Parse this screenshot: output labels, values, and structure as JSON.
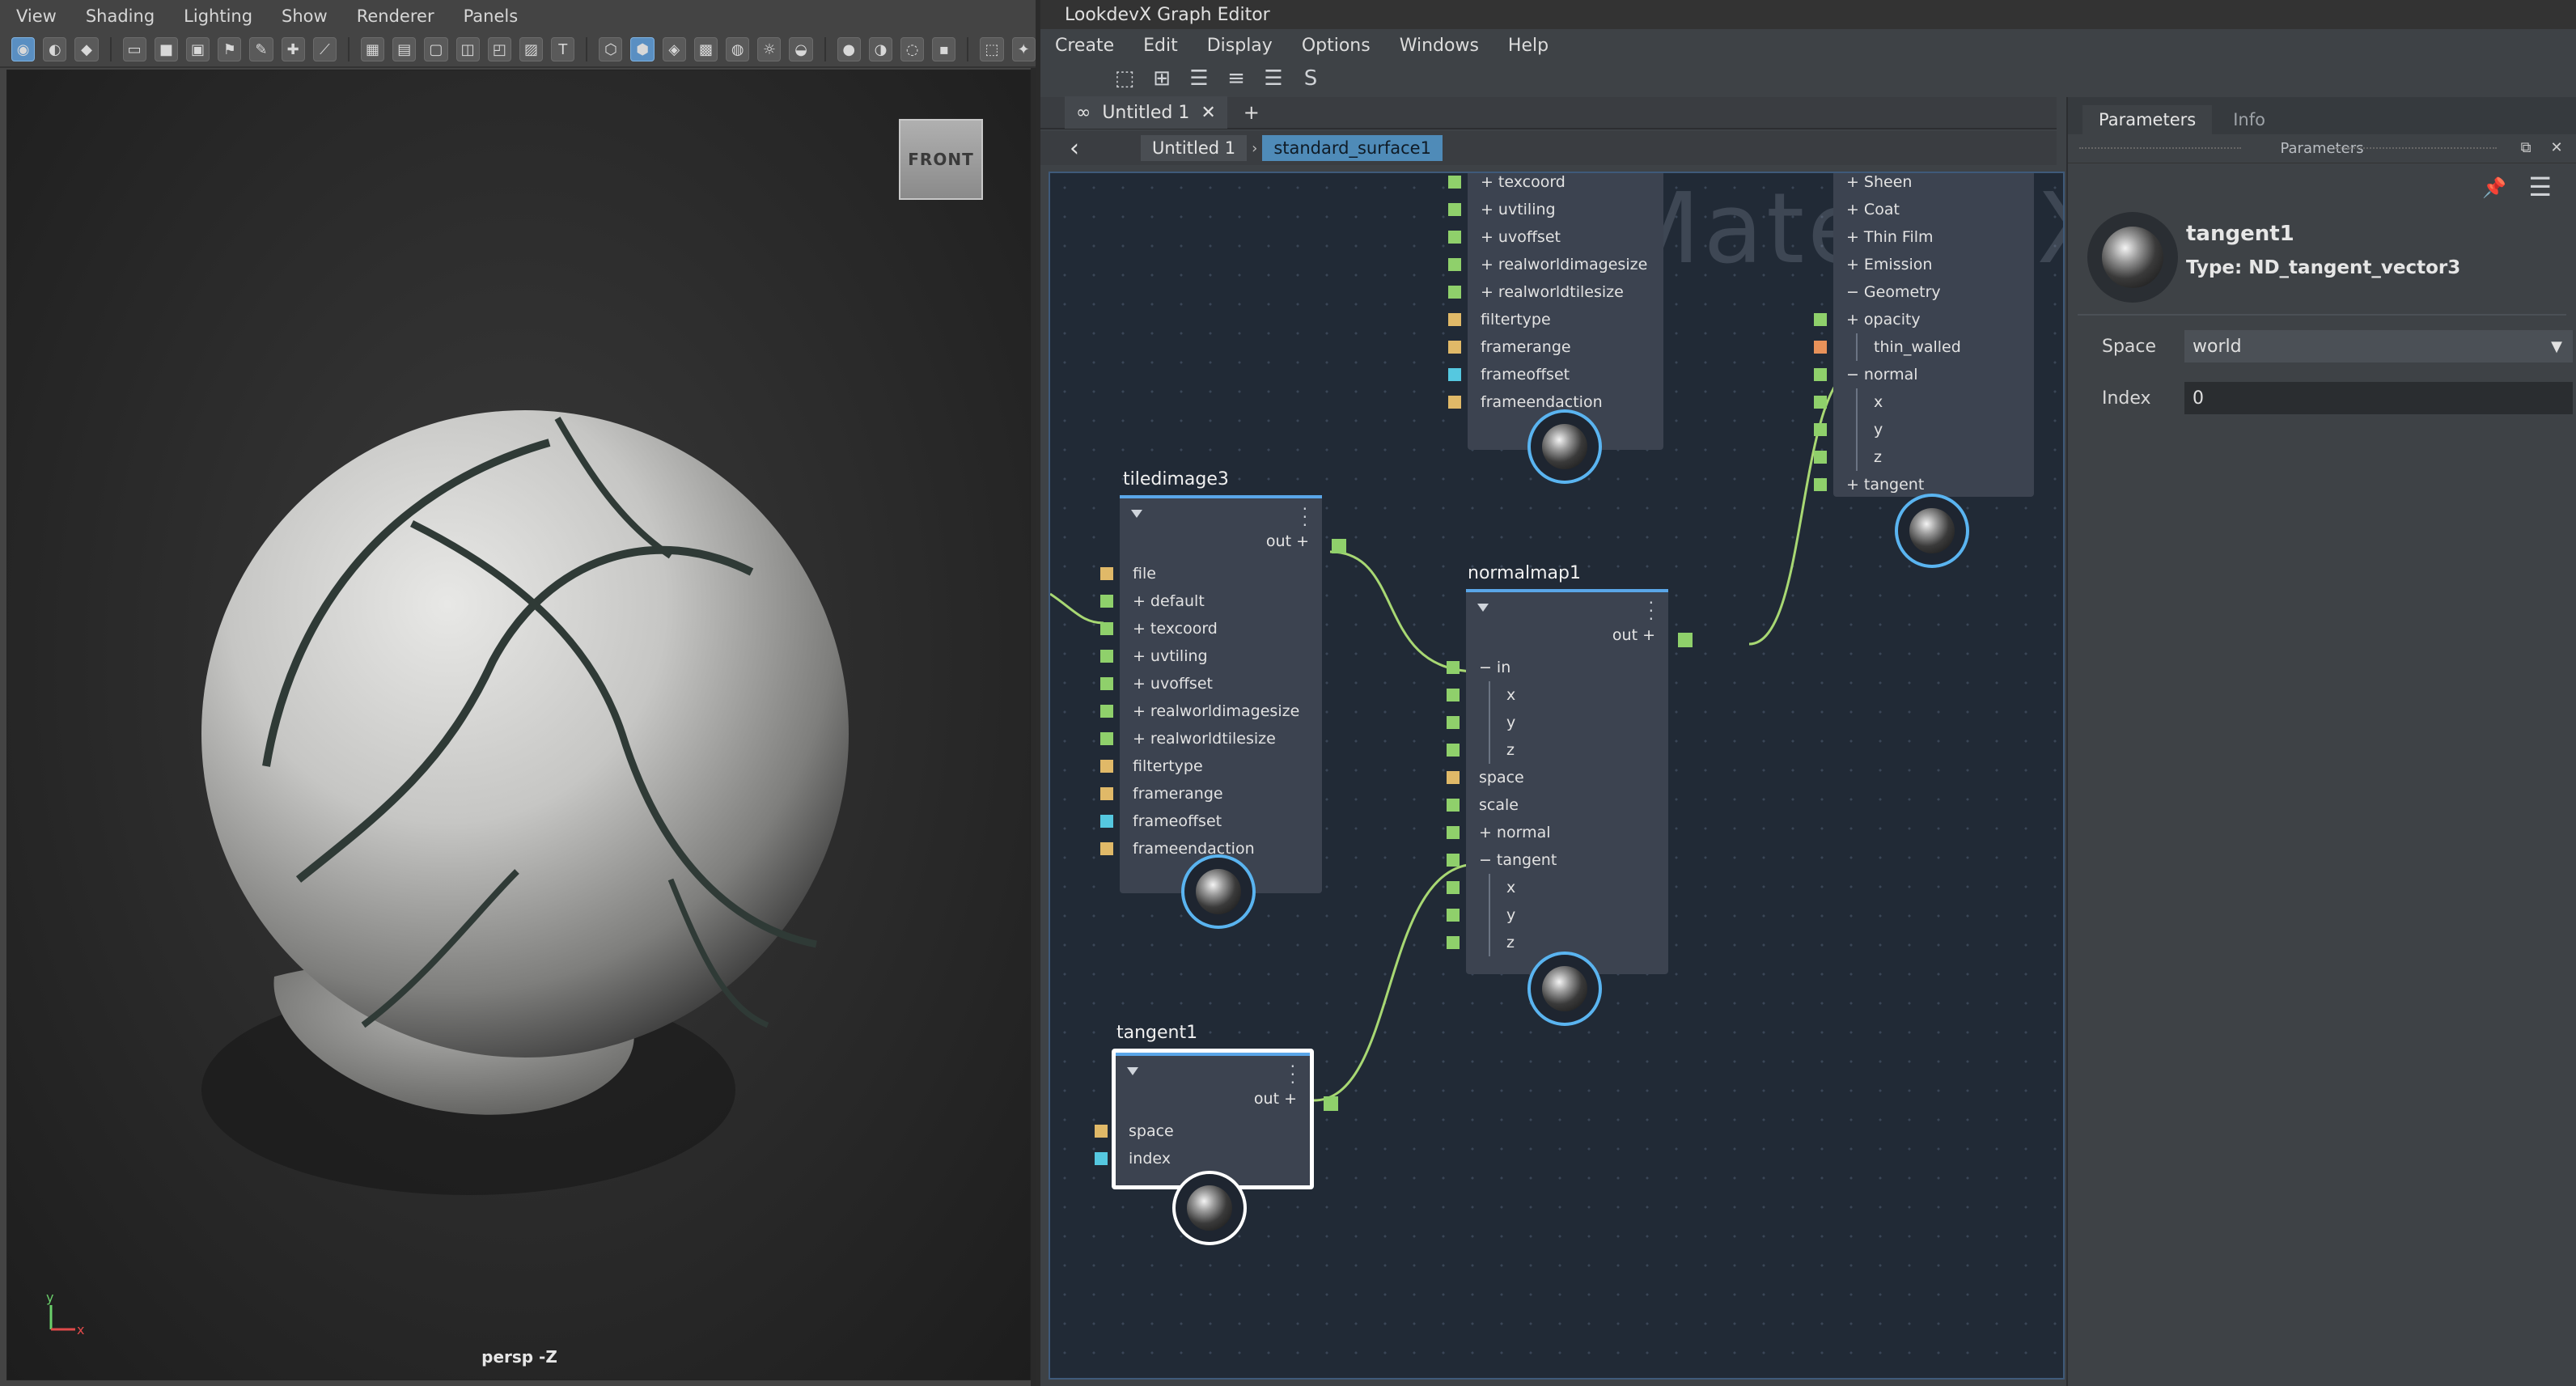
{
  "viewport": {
    "menu": [
      "View",
      "Shading",
      "Lighting",
      "Show",
      "Renderer",
      "Panels"
    ],
    "view_cube_label": "FRONT",
    "camera_label": "persp -Z",
    "axis": {
      "y": "y",
      "x": "x"
    }
  },
  "editor": {
    "title": "LookdevX Graph Editor",
    "menu": [
      "Create",
      "Edit",
      "Display",
      "Options",
      "Windows",
      "Help"
    ],
    "tab": {
      "label": "Untitled 1",
      "close": "✕",
      "add": "+"
    },
    "breadcrumb": [
      "Untitled 1",
      "standard_surface1"
    ],
    "breadcrumb_sep": "›",
    "back": "‹",
    "watermark": "MaterialX"
  },
  "nodes": {
    "top_image": {
      "ports": [
        {
          "label": "texcoord",
          "expand": "+",
          "color": "#8fd06b"
        },
        {
          "label": "uvtiling",
          "expand": "+",
          "color": "#8fd06b"
        },
        {
          "label": "uvoffset",
          "expand": "+",
          "color": "#8fd06b"
        },
        {
          "label": "realworldimagesize",
          "expand": "+",
          "color": "#8fd06b"
        },
        {
          "label": "realworldtilesize",
          "expand": "+",
          "color": "#8fd06b"
        },
        {
          "label": "filtertype",
          "expand": "",
          "color": "#e0b968"
        },
        {
          "label": "framerange",
          "expand": "",
          "color": "#e0b968"
        },
        {
          "label": "frameoffset",
          "expand": "",
          "color": "#55c8e0"
        },
        {
          "label": "frameendaction",
          "expand": "",
          "color": "#e0b968"
        }
      ]
    },
    "surface": {
      "ports": [
        {
          "label": "Sheen",
          "expand": "+",
          "color": ""
        },
        {
          "label": "Coat",
          "expand": "+",
          "color": ""
        },
        {
          "label": "Thin Film",
          "expand": "+",
          "color": ""
        },
        {
          "label": "Emission",
          "expand": "+",
          "color": ""
        },
        {
          "label": "Geometry",
          "expand": "−",
          "color": ""
        },
        {
          "label": "opacity",
          "expand": "+",
          "color": "#8fd06b"
        },
        {
          "label": "thin_walled",
          "expand": "",
          "color": "#e8925a"
        },
        {
          "label": "normal",
          "expand": "−",
          "color": "#8fd06b"
        },
        {
          "label": "x",
          "expand": "",
          "color": "#8fd06b"
        },
        {
          "label": "y",
          "expand": "",
          "color": "#8fd06b"
        },
        {
          "label": "z",
          "expand": "",
          "color": "#8fd06b"
        },
        {
          "label": "tangent",
          "expand": "+",
          "color": "#8fd06b"
        }
      ]
    },
    "tiledimage3": {
      "title": "tiledimage3",
      "out": "out +",
      "ports": [
        {
          "label": "file",
          "expand": "",
          "color": "#e0b968"
        },
        {
          "label": "default",
          "expand": "+",
          "color": "#8fd06b"
        },
        {
          "label": "texcoord",
          "expand": "+",
          "color": "#8fd06b"
        },
        {
          "label": "uvtiling",
          "expand": "+",
          "color": "#8fd06b"
        },
        {
          "label": "uvoffset",
          "expand": "+",
          "color": "#8fd06b"
        },
        {
          "label": "realworldimagesize",
          "expand": "+",
          "color": "#8fd06b"
        },
        {
          "label": "realworldtilesize",
          "expand": "+",
          "color": "#8fd06b"
        },
        {
          "label": "filtertype",
          "expand": "",
          "color": "#e0b968"
        },
        {
          "label": "framerange",
          "expand": "",
          "color": "#e0b968"
        },
        {
          "label": "frameoffset",
          "expand": "",
          "color": "#55c8e0"
        },
        {
          "label": "frameendaction",
          "expand": "",
          "color": "#e0b968"
        }
      ]
    },
    "normalmap1": {
      "title": "normalmap1",
      "out": "out +",
      "ports": [
        {
          "label": "in",
          "expand": "−",
          "color": "#8fd06b"
        },
        {
          "label": "x",
          "expand": "",
          "color": "#8fd06b"
        },
        {
          "label": "y",
          "expand": "",
          "color": "#8fd06b"
        },
        {
          "label": "z",
          "expand": "",
          "color": "#8fd06b"
        },
        {
          "label": "space",
          "expand": "",
          "color": "#e0b968"
        },
        {
          "label": "scale",
          "expand": "",
          "color": "#8fd06b"
        },
        {
          "label": "normal",
          "expand": "+",
          "color": "#8fd06b"
        },
        {
          "label": "tangent",
          "expand": "−",
          "color": "#8fd06b"
        },
        {
          "label": "x",
          "expand": "",
          "color": "#8fd06b"
        },
        {
          "label": "y",
          "expand": "",
          "color": "#8fd06b"
        },
        {
          "label": "z",
          "expand": "",
          "color": "#8fd06b"
        }
      ]
    },
    "tangent1": {
      "title": "tangent1",
      "out": "out +",
      "ports": [
        {
          "label": "space",
          "expand": "",
          "color": "#e0b968"
        },
        {
          "label": "index",
          "expand": "",
          "color": "#55c8e0"
        }
      ]
    }
  },
  "params": {
    "tabs": [
      "Parameters",
      "Info"
    ],
    "header": "Parameters",
    "node_name": "tangent1",
    "node_type": "Type: ND_tangent_vector3",
    "fields": [
      {
        "label": "Space",
        "value": "world"
      },
      {
        "label": "Index",
        "value": "0"
      }
    ]
  },
  "colors": {
    "accent": "#5aa6e8",
    "port_vector": "#8fd06b",
    "port_string": "#e0b968",
    "port_int": "#55c8e0",
    "port_bool": "#e8925a"
  }
}
